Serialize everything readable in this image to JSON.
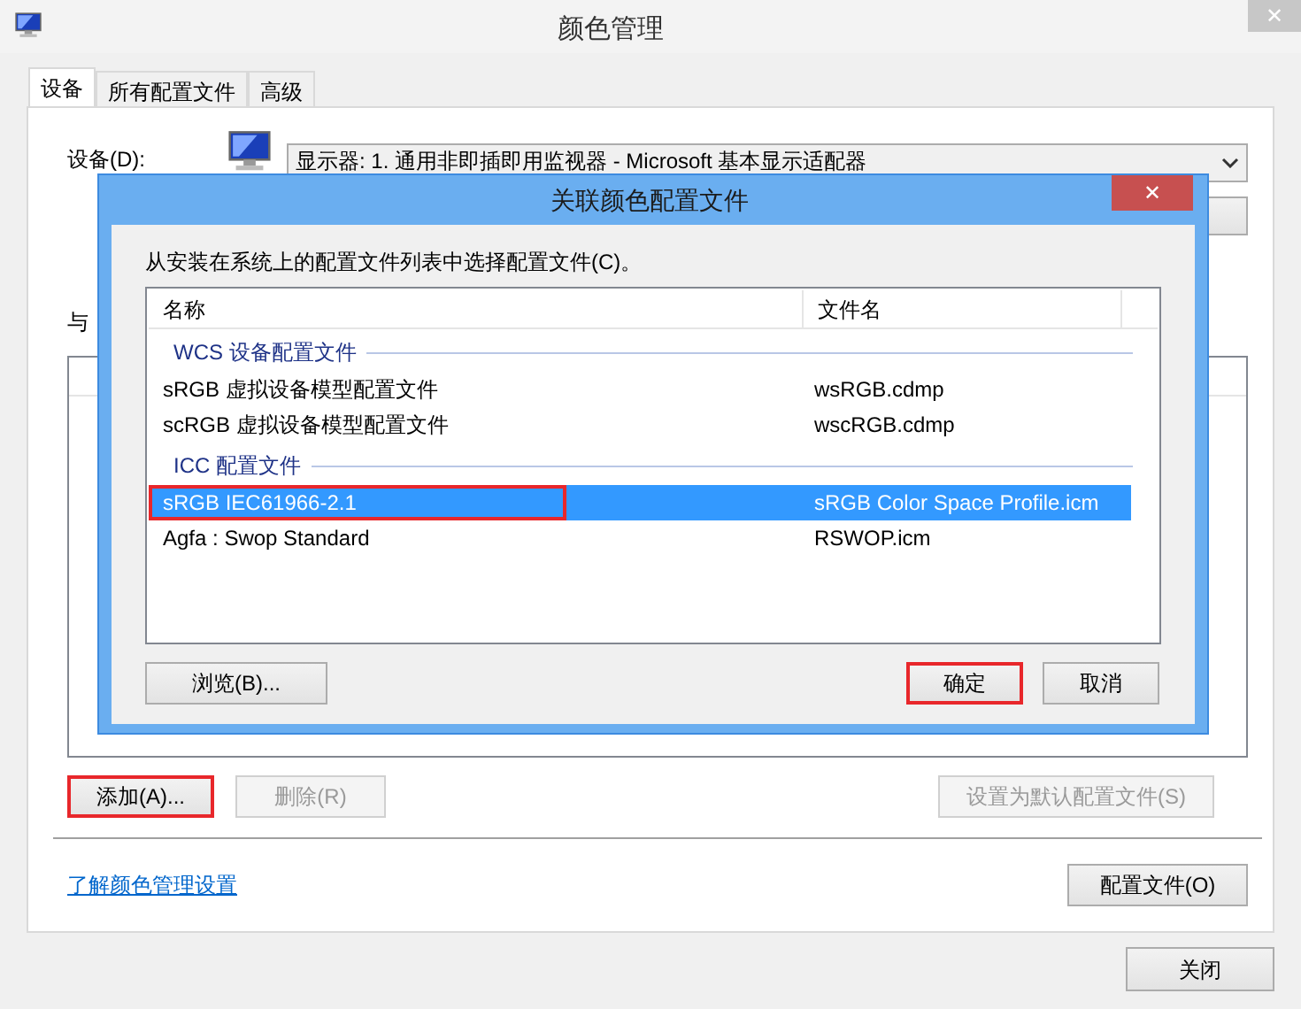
{
  "window": {
    "title": "颜色管理",
    "close": "✕"
  },
  "tabs": [
    {
      "label": "设备",
      "selected": true
    },
    {
      "label": "所有配置文件",
      "selected": false
    },
    {
      "label": "高级",
      "selected": false
    }
  ],
  "device": {
    "label": "设备(D):",
    "value": "显示器: 1. 通用非即插即用监视器 - Microsoft 基本显示适配器"
  },
  "section_label": "与",
  "actions": [
    {
      "label": "添加(A)...",
      "disabled": false,
      "annotated": true
    },
    {
      "label": "删除(R)",
      "disabled": true,
      "annotated": false
    },
    {
      "label": "设置为默认配置文件(S)",
      "disabled": true,
      "annotated": false
    }
  ],
  "link": "了解颜色管理设置",
  "profiles_button": "配置文件(O)",
  "close_button": "关闭",
  "dialog": {
    "title": "关联颜色配置文件",
    "close": "✕",
    "prompt": "从安装在系统上的配置文件列表中选择配置文件(C)。",
    "columns": [
      "名称",
      "文件名"
    ],
    "groups": [
      {
        "name": "WCS 设备配置文件",
        "rows": [
          {
            "name": "sRGB 虚拟设备模型配置文件",
            "file": "wsRGB.cdmp",
            "selected": false,
            "annotated": false
          },
          {
            "name": "scRGB 虚拟设备模型配置文件",
            "file": "wscRGB.cdmp",
            "selected": false,
            "annotated": false
          }
        ]
      },
      {
        "name": "ICC 配置文件",
        "rows": [
          {
            "name": "sRGB IEC61966-2.1",
            "file": "sRGB Color Space Profile.icm",
            "selected": true,
            "annotated": true
          },
          {
            "name": "Agfa : Swop Standard",
            "file": "RSWOP.icm",
            "selected": false,
            "annotated": false
          }
        ]
      }
    ],
    "buttons": [
      {
        "label": "浏览(B)...",
        "annotated": false
      },
      {
        "label": "确定",
        "annotated": true
      },
      {
        "label": "取消",
        "annotated": false
      }
    ]
  }
}
